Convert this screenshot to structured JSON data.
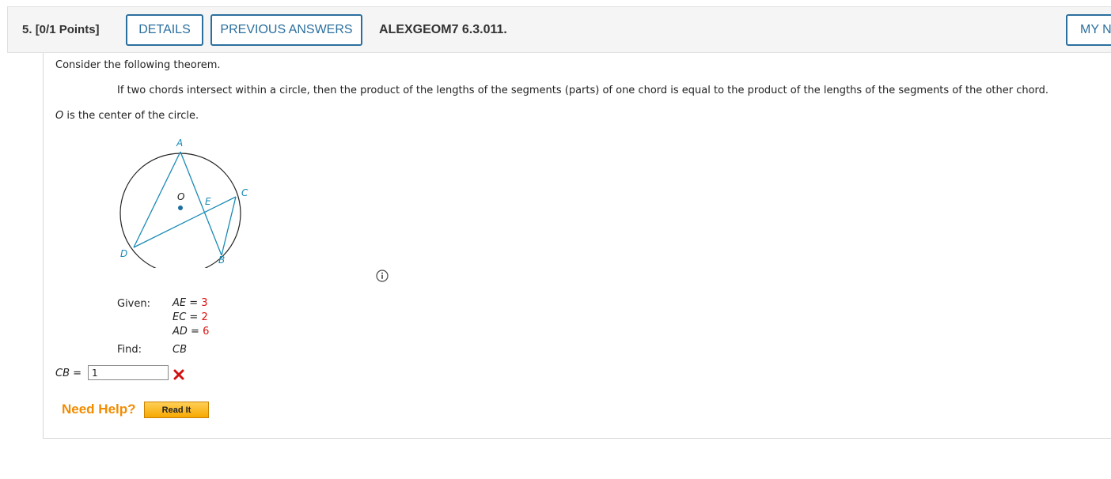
{
  "header": {
    "question_number": "5.",
    "points": "[0/1 Points]",
    "details_label": "DETAILS",
    "previous_answers_label": "PREVIOUS ANSWERS",
    "question_code": "ALEXGEOM7 6.3.011.",
    "my_notes_label": "MY N"
  },
  "content": {
    "intro": "Consider the following theorem.",
    "theorem": "If two chords intersect within a circle, then the product of the lengths of the segments (parts) of one chord is equal to the product of the lengths of the segments of the other chord.",
    "center_note_var": "O",
    "center_note_rest": " is the center of the circle."
  },
  "diagram": {
    "points": {
      "A": "A",
      "B": "B",
      "C": "C",
      "D": "D",
      "E": "E",
      "O": "O"
    },
    "line_color": "#1a8ab5"
  },
  "given": {
    "label": "Given:",
    "items": [
      {
        "name": "AE",
        "value": "3"
      },
      {
        "name": "EC",
        "value": "2"
      },
      {
        "name": "AD",
        "value": "6"
      }
    ]
  },
  "find": {
    "label": "Find:",
    "target": "CB"
  },
  "answer": {
    "label_var": "CB",
    "label_eq": " = ",
    "value": "1",
    "status": "incorrect"
  },
  "help": {
    "need_help": "Need Help?",
    "read_it": "Read It"
  },
  "colors": {
    "accent": "#2b6f9e",
    "help": "#f28c00",
    "wrong": "#d11111"
  }
}
